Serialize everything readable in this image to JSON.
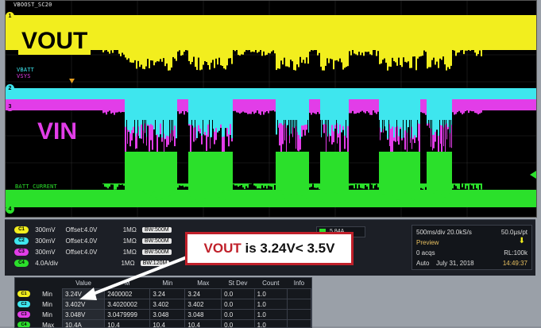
{
  "scope": {
    "top_label": "VBOOST_SC20",
    "vbatt_label": "VBATT",
    "vsys_label": "VSYS",
    "batt_label": "BATT_CURRENT",
    "markers": [
      "1",
      "2",
      "3",
      "4"
    ]
  },
  "annotations": {
    "vout": "VOUT",
    "vin": "VIN",
    "callout_prefix": "VOUT",
    "callout_rest": " is 3.24V< 3.5V"
  },
  "colors": {
    "ch1": "#f2ee1e",
    "ch2": "#3ee6ee",
    "ch3": "#e23de8",
    "ch4": "#2be02b",
    "callout_border": "#c0202a"
  },
  "channels": [
    {
      "id": "C1",
      "scale": "300mV",
      "offset": "Offset:4.0V",
      "imp": "1MΩ",
      "bw": "BW:500M"
    },
    {
      "id": "C2",
      "scale": "300mV",
      "offset": "Offset:4.0V",
      "imp": "1MΩ",
      "bw": "BW:500M"
    },
    {
      "id": "C3",
      "scale": "300mV",
      "offset": "Offset:4.0V",
      "imp": "1MΩ",
      "bw": "BW:500M"
    },
    {
      "id": "C4",
      "scale": "4.0A/div",
      "offset": "",
      "imp": "1MΩ",
      "bw": "BW:120M"
    }
  ],
  "trigger": {
    "label": "5.84A"
  },
  "acquisition": {
    "horizontal": "500ms/div  20.0kS/s",
    "resolution": "50.0µs/pt",
    "mode": "Preview",
    "acqs": "0 acqs",
    "rl": "RL:100k",
    "status": "Auto",
    "date": "July 31, 2018",
    "time": "14:49:37"
  },
  "measurements": {
    "headers": [
      "",
      "",
      "Value",
      "M",
      "Min",
      "Max",
      "St Dev",
      "Count",
      "Info"
    ],
    "rows": [
      {
        "ch": "C1",
        "stat": "Min",
        "value": "3.24V",
        "mean": "2400002",
        "min": "3.24",
        "max": "3.24",
        "stdev": "0.0",
        "count": "1.0"
      },
      {
        "ch": "C2",
        "stat": "Min",
        "value": "3.402V",
        "mean": "3.4020002",
        "min": "3.402",
        "max": "3.402",
        "stdev": "0.0",
        "count": "1.0"
      },
      {
        "ch": "C3",
        "stat": "Min",
        "value": "3.048V",
        "mean": "3.0479999",
        "min": "3.048",
        "max": "3.048",
        "stdev": "0.0",
        "count": "1.0"
      },
      {
        "ch": "C4",
        "stat": "Max",
        "value": "10.4A",
        "mean": "10.4",
        "min": "10.4",
        "max": "10.4",
        "stdev": "0.0",
        "count": "1.0"
      }
    ]
  }
}
